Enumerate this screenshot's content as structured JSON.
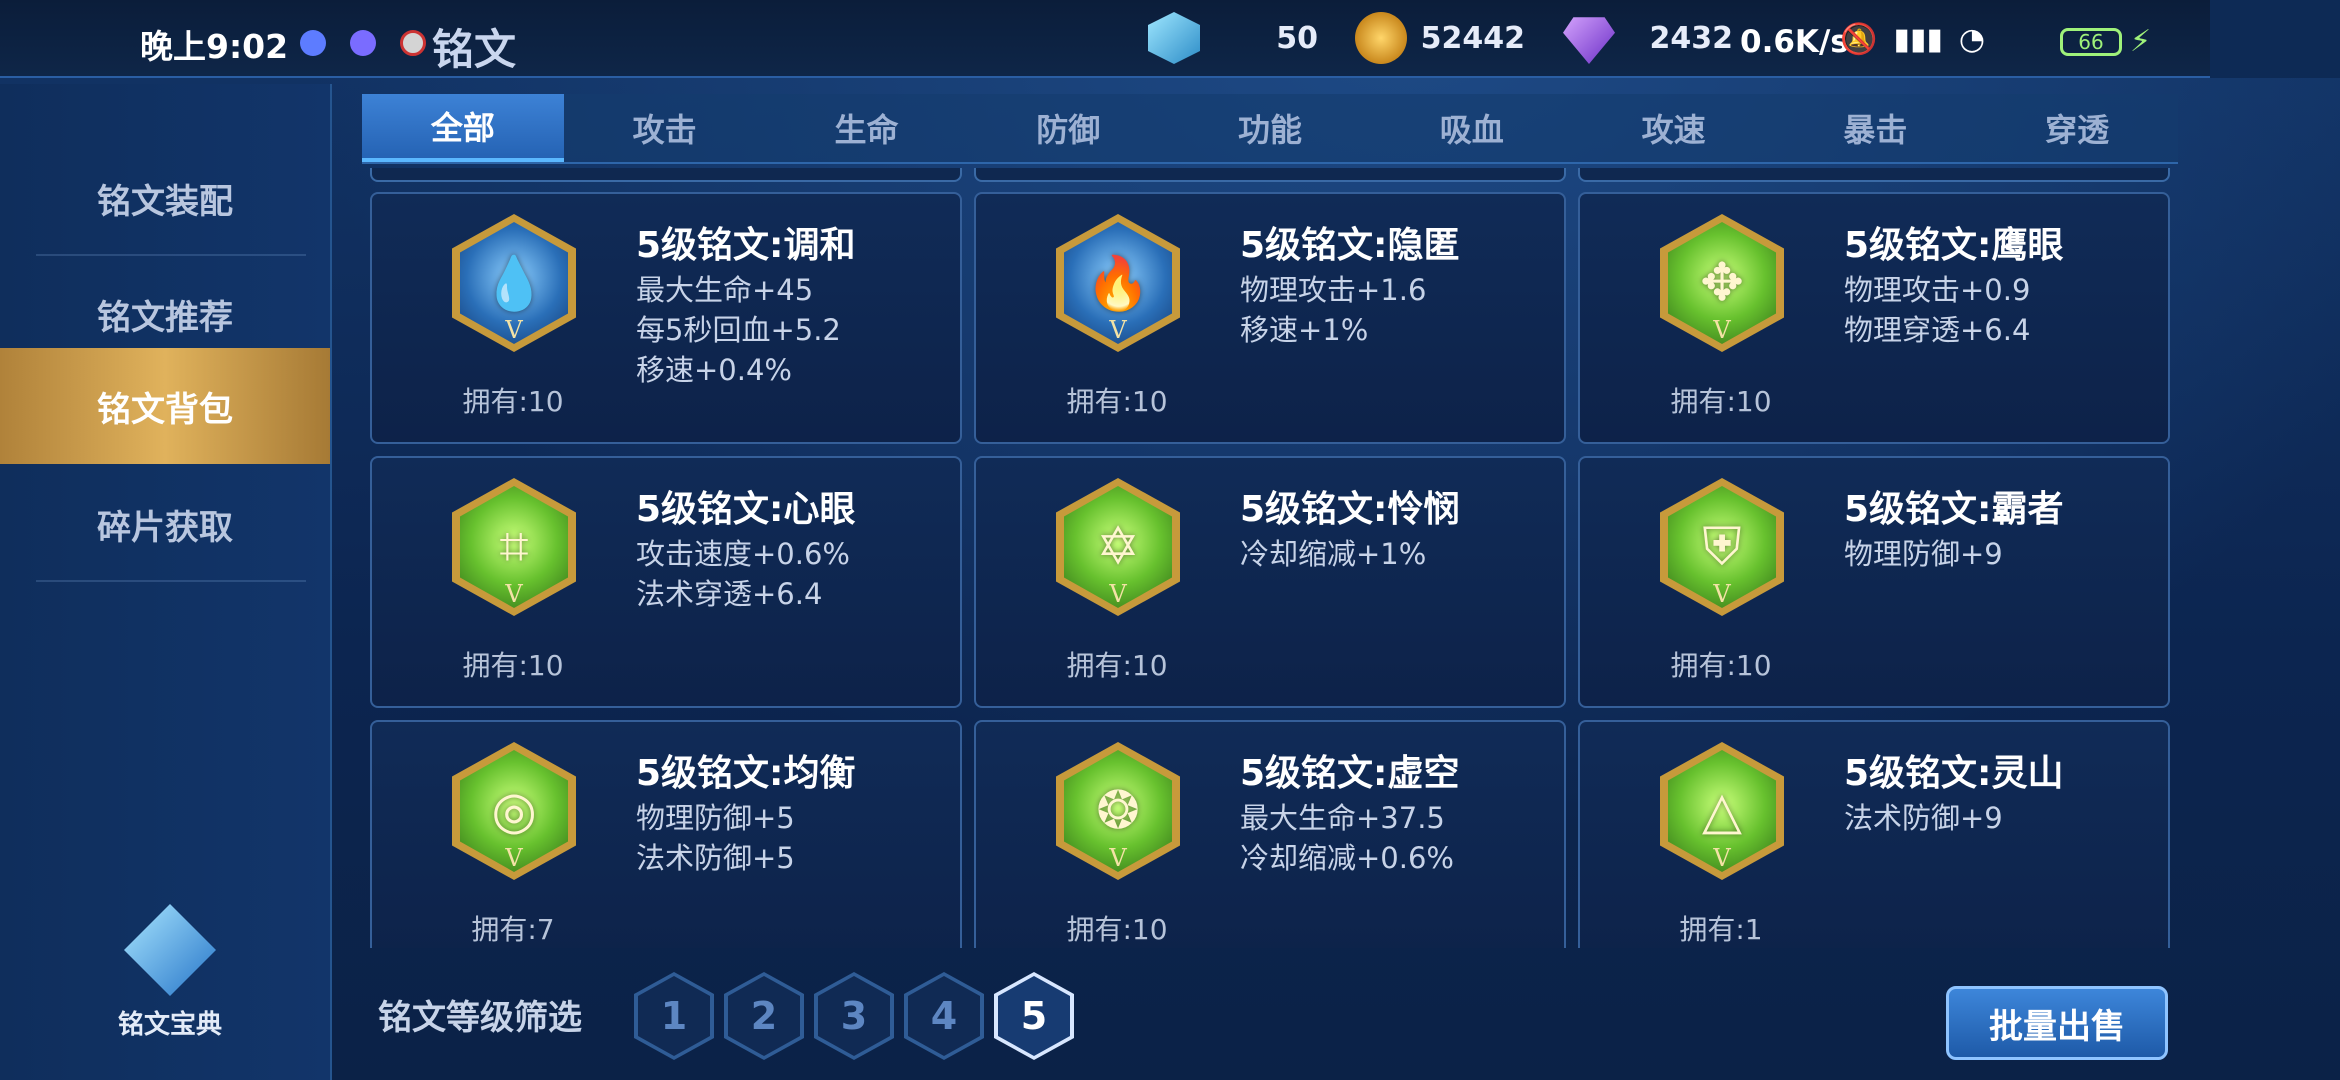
{
  "status_bar": {
    "time": "晚上9:02",
    "net_speed": "0.6K/s",
    "battery": "66"
  },
  "header": {
    "title": "铭文",
    "currencies": [
      {
        "icon": "crystal-icon",
        "value": "50"
      },
      {
        "icon": "gold-coin-icon",
        "value": "52442"
      },
      {
        "icon": "purple-gem-icon",
        "value": "2432"
      }
    ]
  },
  "sidebar": {
    "items": [
      {
        "label": "铭文装配",
        "active": false
      },
      {
        "label": "铭文推荐",
        "active": false
      },
      {
        "label": "铭文背包",
        "active": true
      },
      {
        "label": "碎片获取",
        "active": false
      }
    ],
    "codex_label": "铭文宝典"
  },
  "tabs": [
    {
      "label": "全部",
      "active": true
    },
    {
      "label": "攻击",
      "active": false
    },
    {
      "label": "生命",
      "active": false
    },
    {
      "label": "防御",
      "active": false
    },
    {
      "label": "功能",
      "active": false
    },
    {
      "label": "吸血",
      "active": false
    },
    {
      "label": "攻速",
      "active": false
    },
    {
      "label": "暴击",
      "active": false
    },
    {
      "label": "穿透",
      "active": false
    }
  ],
  "cards": [
    {
      "title": "5级铭文:调和",
      "stats": [
        "最大生命+45",
        "每5秒回血+5.2",
        "移速+0.4%"
      ],
      "owned": "拥有:10",
      "color": "blue",
      "glyph": "💧"
    },
    {
      "title": "5级铭文:隐匿",
      "stats": [
        "物理攻击+1.6",
        "移速+1%"
      ],
      "owned": "拥有:10",
      "color": "blue",
      "glyph": "🔥"
    },
    {
      "title": "5级铭文:鹰眼",
      "stats": [
        "物理攻击+0.9",
        "物理穿透+6.4"
      ],
      "owned": "拥有:10",
      "color": "green",
      "glyph": "✥"
    },
    {
      "title": "5级铭文:心眼",
      "stats": [
        "攻击速度+0.6%",
        "法术穿透+6.4"
      ],
      "owned": "拥有:10",
      "color": "green",
      "glyph": "⌗"
    },
    {
      "title": "5级铭文:怜悯",
      "stats": [
        "冷却缩减+1%"
      ],
      "owned": "拥有:10",
      "color": "green",
      "glyph": "✡"
    },
    {
      "title": "5级铭文:霸者",
      "stats": [
        "物理防御+9"
      ],
      "owned": "拥有:10",
      "color": "green",
      "glyph": "⛨"
    },
    {
      "title": "5级铭文:均衡",
      "stats": [
        "物理防御+5",
        "法术防御+5"
      ],
      "owned": "拥有:7",
      "color": "green",
      "glyph": "◎"
    },
    {
      "title": "5级铭文:虚空",
      "stats": [
        "最大生命+37.5",
        "冷却缩减+0.6%"
      ],
      "owned": "拥有:10",
      "color": "green",
      "glyph": "❂"
    },
    {
      "title": "5级铭文:灵山",
      "stats": [
        "法术防御+9"
      ],
      "owned": "拥有:1",
      "color": "green",
      "glyph": "△"
    }
  ],
  "emblem_level_mark": "V",
  "filter": {
    "label": "铭文等级筛选",
    "levels": [
      "1",
      "2",
      "3",
      "4",
      "5"
    ],
    "selected": "5"
  },
  "batch_sell_label": "批量出售"
}
